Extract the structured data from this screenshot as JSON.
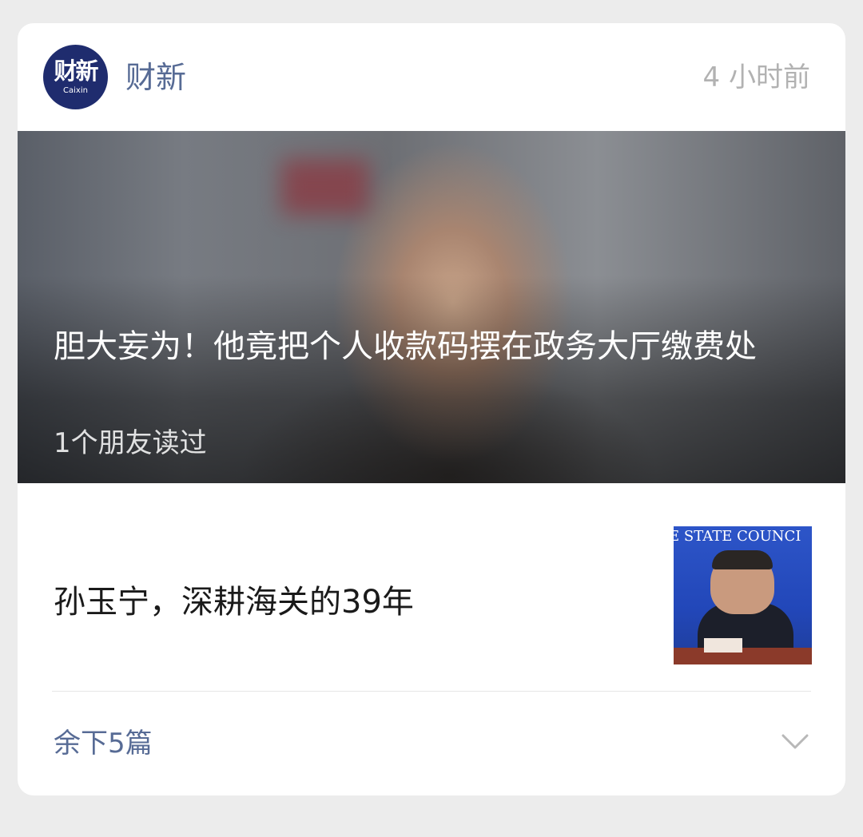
{
  "header": {
    "logo_text": "财新",
    "logo_sub": "Caixin",
    "account_name": "财新",
    "time": "4 小时前"
  },
  "hero": {
    "title": "胆大妄为！他竟把个人收款码摆在政务大厅缴费处",
    "subtitle": "1个朋友读过"
  },
  "article": {
    "title": "孙玉宁，深耕海关的39年",
    "thumb_banner": "E STATE COUNCI"
  },
  "footer": {
    "more_label": "余下5篇",
    "icon": "chevron-down-icon"
  },
  "colors": {
    "link": "#576b95",
    "time": "#b2b2b2",
    "logo_bg": "#1f2c6e"
  }
}
